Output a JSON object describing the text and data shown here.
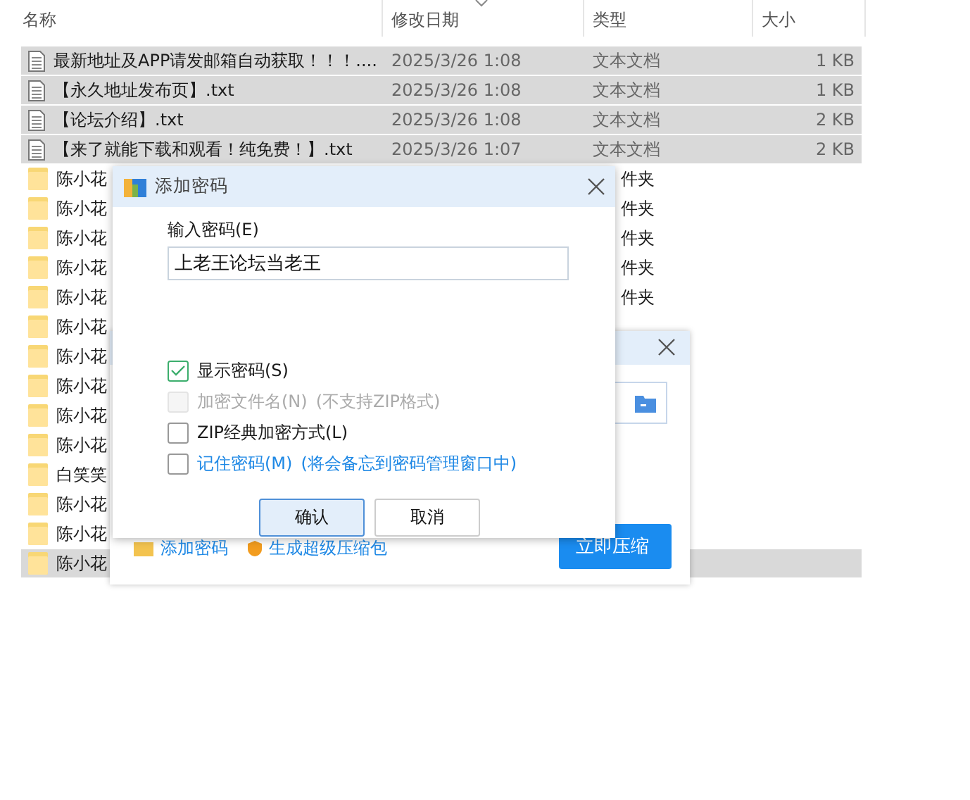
{
  "explorer": {
    "columns": [
      {
        "label": "名称",
        "sorted": false
      },
      {
        "label": "修改日期",
        "sorted": true
      },
      {
        "label": "类型",
        "sorted": false
      },
      {
        "label": "大小",
        "sorted": false
      }
    ],
    "rows": [
      {
        "kind": "file",
        "name": "最新地址及APP请发邮箱自动获取！！！....",
        "date": "2025/3/26 1:08",
        "type": "文本文档",
        "size": "1 KB",
        "selected": true
      },
      {
        "kind": "file",
        "name": "【永久地址发布页】.txt",
        "date": "2025/3/26 1:08",
        "type": "文本文档",
        "size": "1 KB",
        "selected": true
      },
      {
        "kind": "file",
        "name": "【论坛介绍】.txt",
        "date": "2025/3/26 1:08",
        "type": "文本文档",
        "size": "2 KB",
        "selected": true
      },
      {
        "kind": "file",
        "name": "【来了就能下载和观看！纯免费！】.txt",
        "date": "2025/3/26 1:07",
        "type": "文本文档",
        "size": "2 KB",
        "selected": true
      },
      {
        "kind": "folder",
        "name": "陈小花",
        "type": "件夹",
        "selected": false
      },
      {
        "kind": "folder",
        "name": "陈小花",
        "type": "件夹",
        "selected": false
      },
      {
        "kind": "folder",
        "name": "陈小花",
        "type": "件夹",
        "selected": false
      },
      {
        "kind": "folder",
        "name": "陈小花",
        "type": "件夹",
        "selected": false
      },
      {
        "kind": "folder",
        "name": "陈小花",
        "type": "件夹",
        "selected": false
      },
      {
        "kind": "folder",
        "name": "陈小花",
        "selected": false
      },
      {
        "kind": "folder",
        "name": "陈小花",
        "selected": false
      },
      {
        "kind": "folder",
        "name": "陈小花",
        "selected": false
      },
      {
        "kind": "folder",
        "name": "陈小花",
        "selected": false
      },
      {
        "kind": "folder",
        "name": "陈小花",
        "selected": false
      },
      {
        "kind": "folder",
        "name": "白笑笑",
        "selected": false
      },
      {
        "kind": "folder",
        "name": "陈小花",
        "selected": false
      },
      {
        "kind": "folder",
        "name": "陈小花",
        "selected": false
      },
      {
        "kind": "folder",
        "name": "陈小花",
        "selected": true
      }
    ]
  },
  "compress_dialog": {
    "links": [
      "添加密码",
      "生成超级压缩包"
    ],
    "primary_button": "立即压缩"
  },
  "password_dialog": {
    "title": "添加密码",
    "field_label": "输入密码(E)",
    "value": "上老王论坛当老王",
    "options": [
      {
        "kind": "plain",
        "label": "显示密码(S)",
        "checked": true,
        "disabled": false
      },
      {
        "kind": "plain",
        "label": "加密文件名(N)",
        "note": "(不支持ZIP格式)",
        "checked": false,
        "disabled": true
      },
      {
        "kind": "plain",
        "label": "ZIP经典加密方式(L)",
        "checked": false,
        "disabled": false
      },
      {
        "kind": "link",
        "label": "记住密码(M)",
        "note": "(将会备忘到密码管理窗口中)",
        "checked": false,
        "disabled": false
      }
    ],
    "buttons": [
      {
        "label": "确认",
        "default": true
      },
      {
        "label": "取消",
        "default": false
      }
    ]
  }
}
